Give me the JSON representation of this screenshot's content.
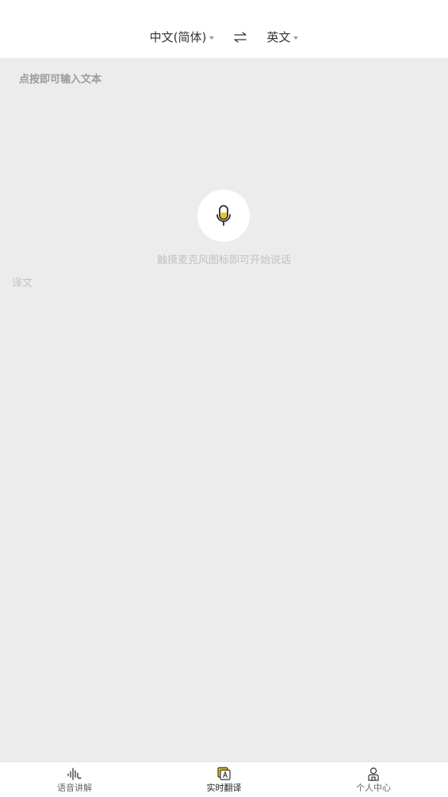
{
  "header": {
    "source_lang": "中文(简体)",
    "target_lang": "英文"
  },
  "input": {
    "placeholder": "点按即可输入文本"
  },
  "mic": {
    "hint": "触摸麦克风图标即可开始说话",
    "accent_color": "#f5c400"
  },
  "output": {
    "label": "译文"
  },
  "nav": {
    "items": [
      {
        "label": "语音讲解",
        "icon": "sound-wave-icon"
      },
      {
        "label": "实时翻译",
        "icon": "translate-icon",
        "active": true
      },
      {
        "label": "个人中心",
        "icon": "person-icon"
      }
    ]
  }
}
